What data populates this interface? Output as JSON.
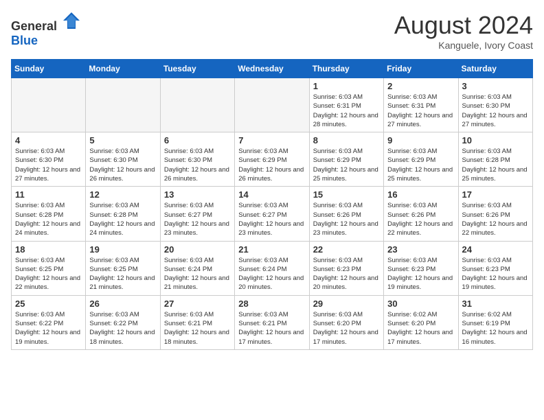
{
  "header": {
    "logo_general": "General",
    "logo_blue": "Blue",
    "month_year": "August 2024",
    "location": "Kanguele, Ivory Coast"
  },
  "weekdays": [
    "Sunday",
    "Monday",
    "Tuesday",
    "Wednesday",
    "Thursday",
    "Friday",
    "Saturday"
  ],
  "weeks": [
    [
      {
        "day": "",
        "empty": true
      },
      {
        "day": "",
        "empty": true
      },
      {
        "day": "",
        "empty": true
      },
      {
        "day": "",
        "empty": true
      },
      {
        "day": "1",
        "sunrise": "6:03 AM",
        "sunset": "6:31 PM",
        "daylight": "12 hours and 28 minutes."
      },
      {
        "day": "2",
        "sunrise": "6:03 AM",
        "sunset": "6:31 PM",
        "daylight": "12 hours and 27 minutes."
      },
      {
        "day": "3",
        "sunrise": "6:03 AM",
        "sunset": "6:30 PM",
        "daylight": "12 hours and 27 minutes."
      }
    ],
    [
      {
        "day": "4",
        "sunrise": "6:03 AM",
        "sunset": "6:30 PM",
        "daylight": "12 hours and 27 minutes."
      },
      {
        "day": "5",
        "sunrise": "6:03 AM",
        "sunset": "6:30 PM",
        "daylight": "12 hours and 26 minutes."
      },
      {
        "day": "6",
        "sunrise": "6:03 AM",
        "sunset": "6:30 PM",
        "daylight": "12 hours and 26 minutes."
      },
      {
        "day": "7",
        "sunrise": "6:03 AM",
        "sunset": "6:29 PM",
        "daylight": "12 hours and 26 minutes."
      },
      {
        "day": "8",
        "sunrise": "6:03 AM",
        "sunset": "6:29 PM",
        "daylight": "12 hours and 25 minutes."
      },
      {
        "day": "9",
        "sunrise": "6:03 AM",
        "sunset": "6:29 PM",
        "daylight": "12 hours and 25 minutes."
      },
      {
        "day": "10",
        "sunrise": "6:03 AM",
        "sunset": "6:28 PM",
        "daylight": "12 hours and 25 minutes."
      }
    ],
    [
      {
        "day": "11",
        "sunrise": "6:03 AM",
        "sunset": "6:28 PM",
        "daylight": "12 hours and 24 minutes."
      },
      {
        "day": "12",
        "sunrise": "6:03 AM",
        "sunset": "6:28 PM",
        "daylight": "12 hours and 24 minutes."
      },
      {
        "day": "13",
        "sunrise": "6:03 AM",
        "sunset": "6:27 PM",
        "daylight": "12 hours and 23 minutes."
      },
      {
        "day": "14",
        "sunrise": "6:03 AM",
        "sunset": "6:27 PM",
        "daylight": "12 hours and 23 minutes."
      },
      {
        "day": "15",
        "sunrise": "6:03 AM",
        "sunset": "6:26 PM",
        "daylight": "12 hours and 23 minutes."
      },
      {
        "day": "16",
        "sunrise": "6:03 AM",
        "sunset": "6:26 PM",
        "daylight": "12 hours and 22 minutes."
      },
      {
        "day": "17",
        "sunrise": "6:03 AM",
        "sunset": "6:26 PM",
        "daylight": "12 hours and 22 minutes."
      }
    ],
    [
      {
        "day": "18",
        "sunrise": "6:03 AM",
        "sunset": "6:25 PM",
        "daylight": "12 hours and 22 minutes."
      },
      {
        "day": "19",
        "sunrise": "6:03 AM",
        "sunset": "6:25 PM",
        "daylight": "12 hours and 21 minutes."
      },
      {
        "day": "20",
        "sunrise": "6:03 AM",
        "sunset": "6:24 PM",
        "daylight": "12 hours and 21 minutes."
      },
      {
        "day": "21",
        "sunrise": "6:03 AM",
        "sunset": "6:24 PM",
        "daylight": "12 hours and 20 minutes."
      },
      {
        "day": "22",
        "sunrise": "6:03 AM",
        "sunset": "6:23 PM",
        "daylight": "12 hours and 20 minutes."
      },
      {
        "day": "23",
        "sunrise": "6:03 AM",
        "sunset": "6:23 PM",
        "daylight": "12 hours and 19 minutes."
      },
      {
        "day": "24",
        "sunrise": "6:03 AM",
        "sunset": "6:23 PM",
        "daylight": "12 hours and 19 minutes."
      }
    ],
    [
      {
        "day": "25",
        "sunrise": "6:03 AM",
        "sunset": "6:22 PM",
        "daylight": "12 hours and 19 minutes."
      },
      {
        "day": "26",
        "sunrise": "6:03 AM",
        "sunset": "6:22 PM",
        "daylight": "12 hours and 18 minutes."
      },
      {
        "day": "27",
        "sunrise": "6:03 AM",
        "sunset": "6:21 PM",
        "daylight": "12 hours and 18 minutes."
      },
      {
        "day": "28",
        "sunrise": "6:03 AM",
        "sunset": "6:21 PM",
        "daylight": "12 hours and 17 minutes."
      },
      {
        "day": "29",
        "sunrise": "6:03 AM",
        "sunset": "6:20 PM",
        "daylight": "12 hours and 17 minutes."
      },
      {
        "day": "30",
        "sunrise": "6:02 AM",
        "sunset": "6:20 PM",
        "daylight": "12 hours and 17 minutes."
      },
      {
        "day": "31",
        "sunrise": "6:02 AM",
        "sunset": "6:19 PM",
        "daylight": "12 hours and 16 minutes."
      }
    ]
  ]
}
